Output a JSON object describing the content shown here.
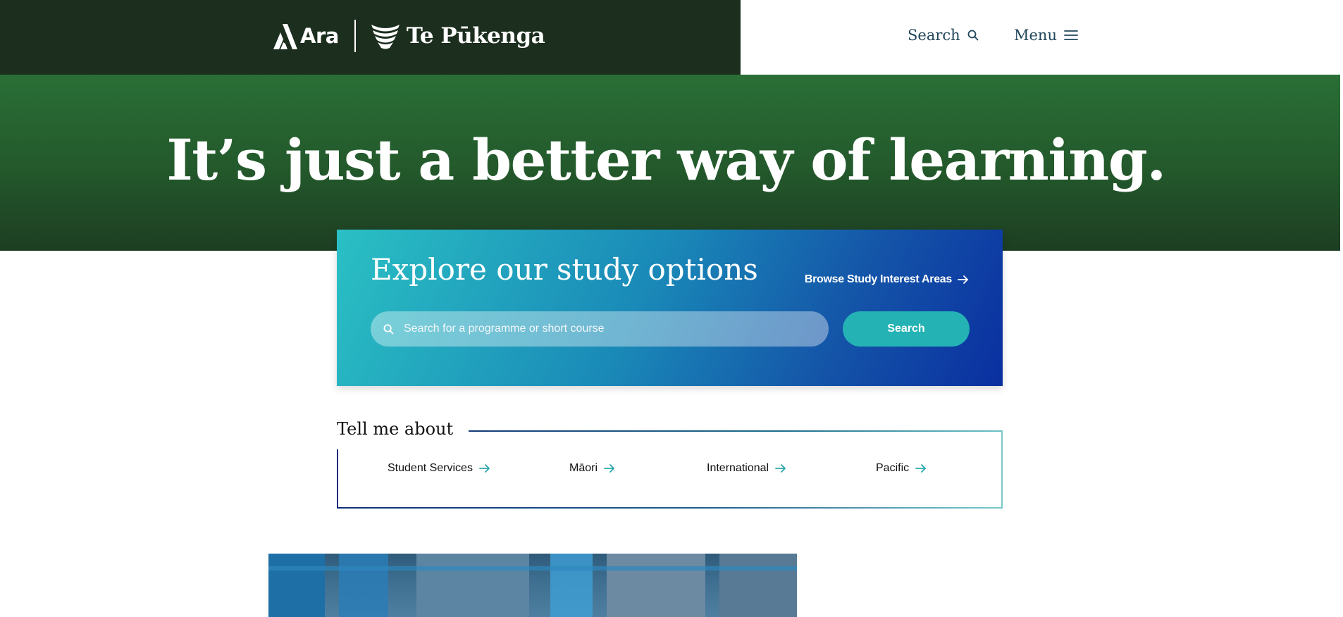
{
  "header": {
    "logo_ara": "Ara",
    "logo_partner": "Te Pūkenga",
    "search_label": "Search",
    "menu_label": "Menu"
  },
  "hero": {
    "title": "It’s just a better way of learning."
  },
  "explore": {
    "title": "Explore our study options",
    "browse_link": "Browse Study Interest Areas",
    "search_placeholder": "Search for a programme or short course",
    "search_value": "",
    "search_button": "Search"
  },
  "tell": {
    "title": "Tell me about",
    "items": [
      {
        "label": "Student Services"
      },
      {
        "label": "Māori"
      },
      {
        "label": "International"
      },
      {
        "label": "Pacific"
      }
    ]
  },
  "colors": {
    "header_bg": "#1c2e1e",
    "hero_green": "#2a6f36",
    "accent_teal": "#24b2b4",
    "accent_blue": "#0a2fa0",
    "nav_text": "#20465a"
  },
  "icons": {
    "search": "search-icon",
    "menu": "hamburger-icon",
    "arrow": "arrow-right-icon"
  }
}
